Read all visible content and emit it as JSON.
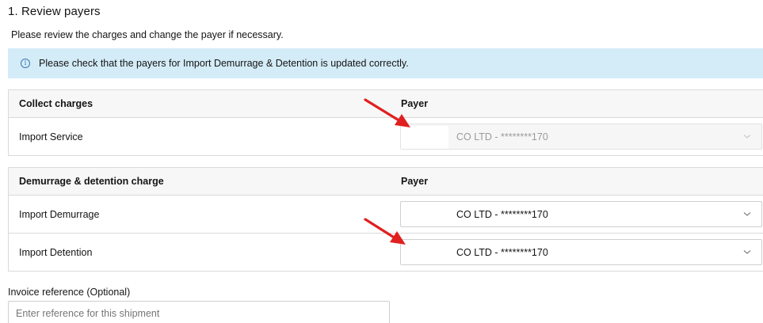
{
  "section_title": "1. Review payers",
  "subtitle": "Please review the charges and change the payer if necessary.",
  "banner": {
    "icon": "info-icon",
    "text": "Please check that the payers for Import Demurrage & Detention is updated correctly."
  },
  "collect_table": {
    "header": {
      "left": "Collect charges",
      "right": "Payer"
    },
    "rows": [
      {
        "charge": "Import Service",
        "payer": "CO LTD - ********170",
        "disabled": true
      }
    ]
  },
  "dd_table": {
    "header": {
      "left": "Demurrage & detention charge",
      "right": "Payer"
    },
    "rows": [
      {
        "charge": "Import Demurrage",
        "payer": "CO LTD - ********170",
        "disabled": false
      },
      {
        "charge": "Import Detention",
        "payer": "CO LTD - ********170",
        "disabled": false
      }
    ]
  },
  "invoice": {
    "label": "Invoice reference (Optional)",
    "placeholder": "Enter reference for this shipment"
  },
  "annotation_color": "#e02020"
}
